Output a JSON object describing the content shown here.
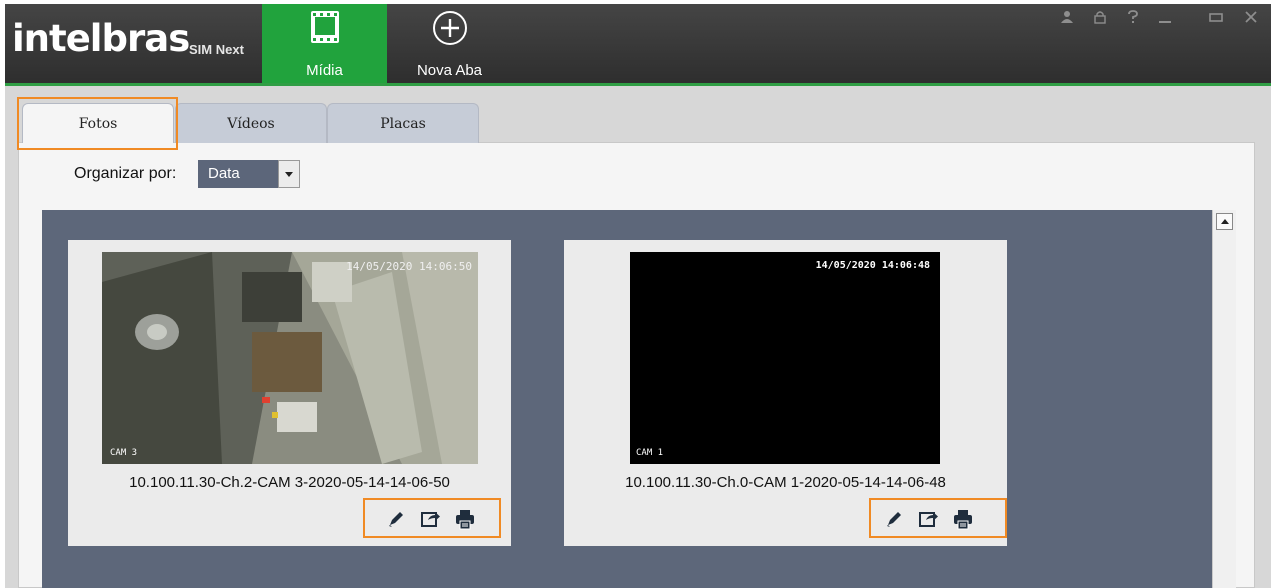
{
  "app": {
    "logo": "intelbras",
    "product": "SIM Next"
  },
  "top_tabs": [
    {
      "label": "Mídia",
      "icon": "media-icon",
      "active": true
    },
    {
      "label": "Nova Aba",
      "icon": "add-tab-icon",
      "active": false
    }
  ],
  "window_controls": [
    "user-icon",
    "lock-icon",
    "help-icon",
    "minimize-icon",
    "maximize-icon",
    "close-icon"
  ],
  "file_tabs": [
    {
      "label": "Fotos",
      "active": true
    },
    {
      "label": "Vídeos",
      "active": false
    },
    {
      "label": "Placas",
      "active": false
    }
  ],
  "organize": {
    "label": "Organizar por:",
    "selected": "Data"
  },
  "photos": [
    {
      "name": "10.100.11.30-Ch.2-CAM 3-2020-05-14-14-06-50",
      "timestamp_overlay": "14/05/2020 14:06:50",
      "camera_overlay": "CAM 3",
      "actions": [
        "edit-icon",
        "export-icon",
        "print-icon"
      ]
    },
    {
      "name": "10.100.11.30-Ch.0-CAM 1-2020-05-14-14-06-48",
      "timestamp_overlay": "14/05/2020 14:06:48",
      "camera_overlay": "CAM 1",
      "actions": [
        "edit-icon",
        "export-icon",
        "print-icon"
      ]
    }
  ],
  "colors": {
    "accent_green": "#21a33d",
    "highlight_orange": "#f08a24",
    "gallery_bg": "#5d677a"
  }
}
